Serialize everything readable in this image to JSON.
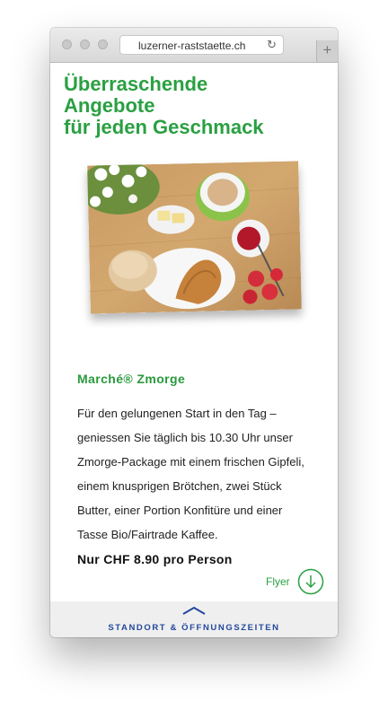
{
  "browser": {
    "url": "luzerner-raststaette.ch",
    "reload_icon": "reload-icon",
    "newtab_icon": "plus-icon"
  },
  "page": {
    "headline": [
      "Überraschende",
      "Angebote",
      "für jeden Geschmack"
    ],
    "image_alt": "breakfast-photo",
    "section_title": "Marché® Zmorge",
    "description": "Für den gelungenen Start in den Tag – geniessen Sie täglich bis 10.30 Uhr unser Zmorge-Package mit einem frischen Gipfeli, einem knusprigen Brötchen, zwei Stück Butter, einer Portion Konfitüre und einer Tasse Bio/Fairtrade Kaffee.",
    "price": "Nur CHF 8.90 pro Person",
    "flyer_label": "Flyer",
    "flyer_icon": "arrow-down-circle-icon"
  },
  "footer": {
    "label": "STANDORT & ÖFFNUNGSZEITEN",
    "icon": "chevron-up-icon"
  },
  "colors": {
    "brand_green": "#2aa042",
    "footer_blue": "#22489c",
    "footer_bg": "#efefef"
  }
}
